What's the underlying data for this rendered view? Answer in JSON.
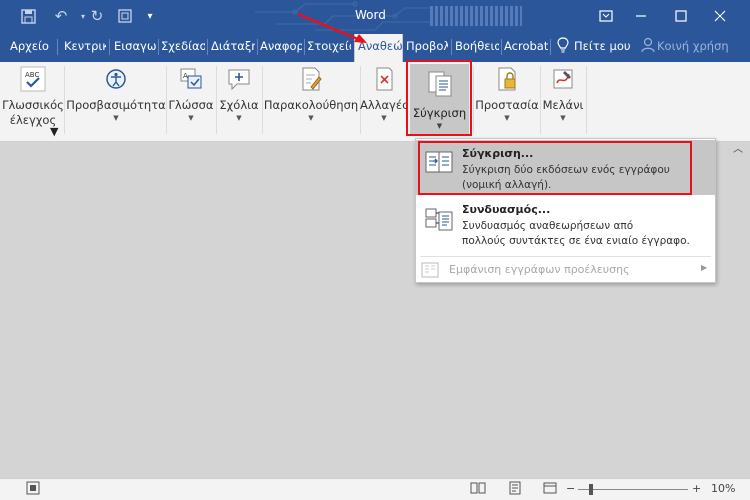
{
  "window": {
    "title": "Word",
    "qat": [
      "save-icon",
      "undo-icon",
      "redo-icon",
      "touch-mode-icon",
      "customize-icon"
    ],
    "controls": [
      "minimize-icon",
      "restore-icon",
      "maximize-icon",
      "close-icon"
    ]
  },
  "tabs": [
    {
      "label": "Αρχείο"
    },
    {
      "label": "Κεντρικ"
    },
    {
      "label": "Εισαγω"
    },
    {
      "label": "Σχεδίασ"
    },
    {
      "label": "Διάταξη"
    },
    {
      "label": "Αναφορ"
    },
    {
      "label": "Στοιχείο"
    },
    {
      "label": "Αναθεώ"
    },
    {
      "label": "Προβολ"
    },
    {
      "label": "Βοήθεια"
    },
    {
      "label": "Acrobat"
    }
  ],
  "tell_me": "Πείτε μου",
  "share": "Κοινή χρήση",
  "ribbon": {
    "groups": [
      {
        "label": "Γλωσσικός",
        "label2": "έλεγχος"
      },
      {
        "label": "Προσβασιμότητα"
      },
      {
        "label": "Γλώσσα"
      },
      {
        "label": "Σχόλια"
      },
      {
        "label": "Παρακολούθηση"
      },
      {
        "label": "Αλλαγές"
      },
      {
        "label": "Σύγκριση"
      },
      {
        "label": "Προστασία"
      },
      {
        "label": "Μελάνι"
      }
    ]
  },
  "menu": {
    "items": [
      {
        "title": "Σύγκριση...",
        "desc1": "Σύγκριση δύο εκδόσεων ενός εγγράφου",
        "desc2": "(νομική αλλαγή)."
      },
      {
        "title": "Συνδυασμός...",
        "desc1": "Συνδυασμός αναθεωρήσεων από",
        "desc2": "πολλούς συντάκτες σε ένα ενιαίο έγγραφο."
      },
      {
        "title": "Εμφάνιση εγγράφων προέλευσης"
      }
    ]
  },
  "status": {
    "zoom": "10%"
  },
  "colors": {
    "brand": "#2b579a",
    "highlight": "#e8101c"
  }
}
